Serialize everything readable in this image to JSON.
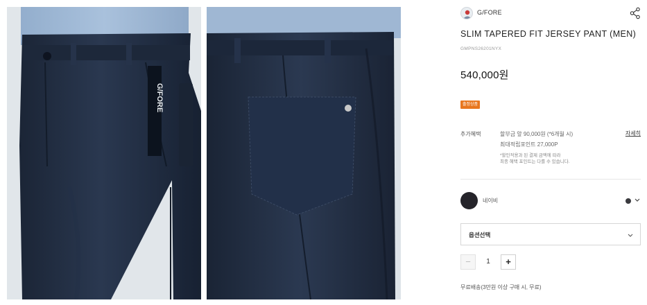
{
  "images": {
    "front": {
      "description_icon": "pants-front-photo",
      "logo_text": "G/FORE"
    },
    "back": {
      "description_icon": "pants-back-photo"
    }
  },
  "brand": {
    "name": "G/FORE",
    "logo_icon": "brand-avatar-icon"
  },
  "share": {
    "icon": "share-icon"
  },
  "product": {
    "title": "SLIM TAPERED FIT JERSEY PANT (MEN)",
    "code": "GMPNS26201NYX",
    "price": "540,000원"
  },
  "badge": {
    "label": "출정상품",
    "color": "#e8771f"
  },
  "additional_info": {
    "label": "추가혜택",
    "line1": "할부금 앞 90,000원 (*6개월 시)",
    "line2": "최대적립포인트 27,000P",
    "note1": "*할인적용과 된 결제 금액에 따라",
    "note2": "최종 혜택 포인트는 다를 수 있습니다.",
    "detail_link": "자세히"
  },
  "color_option": {
    "name": "네이비",
    "swatch_color": "#25242a"
  },
  "option_select": {
    "label": "옵션선택"
  },
  "quantity": {
    "minus": "−",
    "value": "1",
    "plus": "+"
  },
  "shipping": {
    "text": "무료배송(3만원 이상 구매 시, 무료)"
  }
}
